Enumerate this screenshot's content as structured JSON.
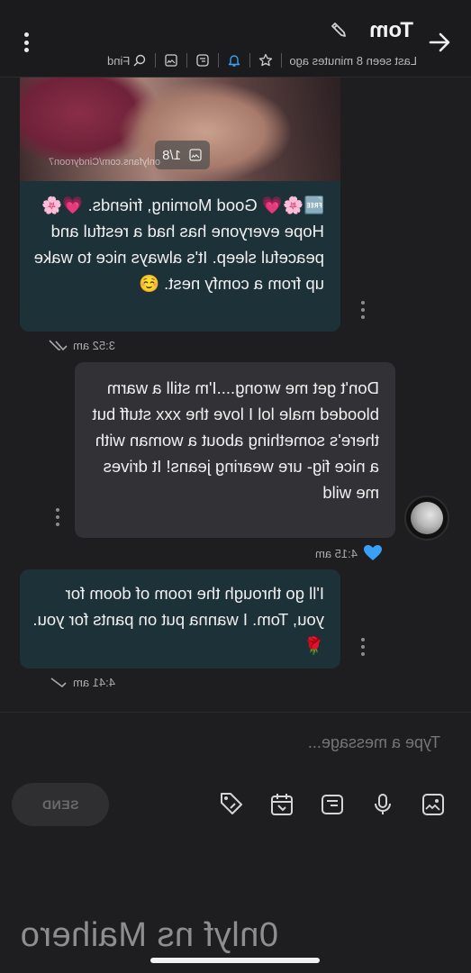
{
  "header": {
    "contact_name": "Tom",
    "last_seen": "Last seen 8 minutes ago",
    "find_label": "Find"
  },
  "messages": [
    {
      "direction": "incoming",
      "media_counter": "1/8",
      "media_credit": "onlyfans.com/Cindyroon7",
      "text": "🆓🌸💗 Good Morning, friends. 💗🌸Hope everyone has had a restful and peaceful sleep. It's always nice to wake up from a comfy nest. ☺️",
      "time": "3:52 am"
    },
    {
      "direction": "outgoing",
      "text": "Don't get me wrong....I'm still a warm blooded male lol I love the xxx stuff but there's something about a woman with a nice fig- ure wearing jeans! It drives me wild",
      "time": "4:15 am",
      "reaction": "💙"
    },
    {
      "direction": "incoming",
      "text": "I'll go through the room of doom for you, Tom. I wanna put on pants for you. 🌹",
      "time": "4:41 am"
    }
  ],
  "composer": {
    "placeholder": "Type a message...",
    "send_label": "SEND"
  },
  "watermark": "0nlyf ns Maihero",
  "colors": {
    "background": "#1e1e20",
    "incoming_bubble": "#1d3138",
    "outgoing_bubble": "#323236",
    "accent_blue": "#3aa0f5"
  }
}
